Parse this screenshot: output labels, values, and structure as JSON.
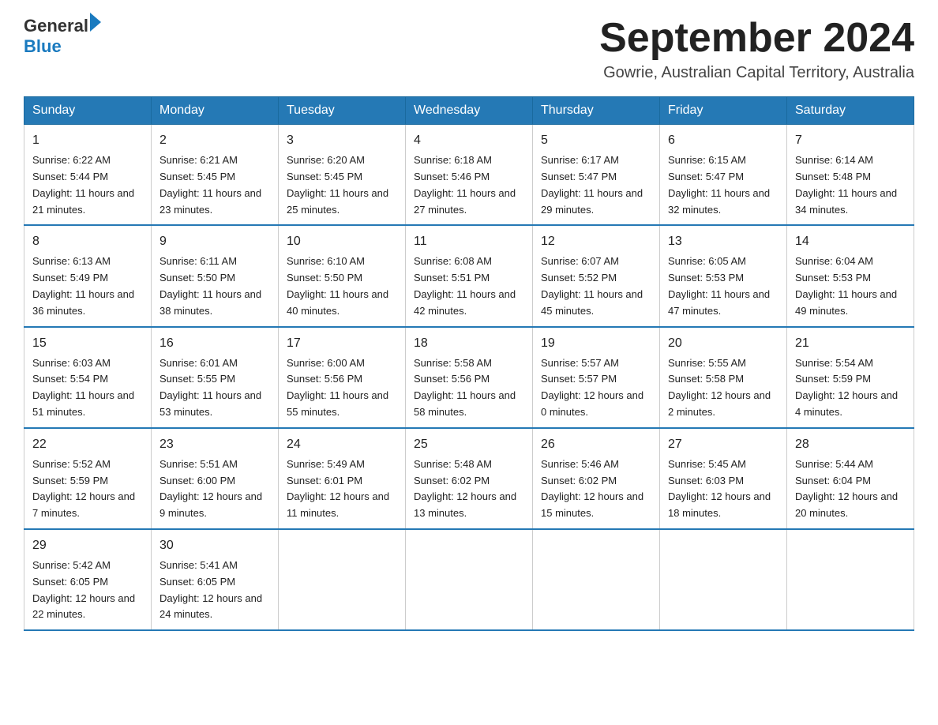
{
  "logo": {
    "general": "General",
    "blue": "Blue"
  },
  "title": "September 2024",
  "location": "Gowrie, Australian Capital Territory, Australia",
  "weekdays": [
    "Sunday",
    "Monday",
    "Tuesday",
    "Wednesday",
    "Thursday",
    "Friday",
    "Saturday"
  ],
  "weeks": [
    [
      {
        "day": "1",
        "sunrise": "6:22 AM",
        "sunset": "5:44 PM",
        "daylight": "11 hours and 21 minutes."
      },
      {
        "day": "2",
        "sunrise": "6:21 AM",
        "sunset": "5:45 PM",
        "daylight": "11 hours and 23 minutes."
      },
      {
        "day": "3",
        "sunrise": "6:20 AM",
        "sunset": "5:45 PM",
        "daylight": "11 hours and 25 minutes."
      },
      {
        "day": "4",
        "sunrise": "6:18 AM",
        "sunset": "5:46 PM",
        "daylight": "11 hours and 27 minutes."
      },
      {
        "day": "5",
        "sunrise": "6:17 AM",
        "sunset": "5:47 PM",
        "daylight": "11 hours and 29 minutes."
      },
      {
        "day": "6",
        "sunrise": "6:15 AM",
        "sunset": "5:47 PM",
        "daylight": "11 hours and 32 minutes."
      },
      {
        "day": "7",
        "sunrise": "6:14 AM",
        "sunset": "5:48 PM",
        "daylight": "11 hours and 34 minutes."
      }
    ],
    [
      {
        "day": "8",
        "sunrise": "6:13 AM",
        "sunset": "5:49 PM",
        "daylight": "11 hours and 36 minutes."
      },
      {
        "day": "9",
        "sunrise": "6:11 AM",
        "sunset": "5:50 PM",
        "daylight": "11 hours and 38 minutes."
      },
      {
        "day": "10",
        "sunrise": "6:10 AM",
        "sunset": "5:50 PM",
        "daylight": "11 hours and 40 minutes."
      },
      {
        "day": "11",
        "sunrise": "6:08 AM",
        "sunset": "5:51 PM",
        "daylight": "11 hours and 42 minutes."
      },
      {
        "day": "12",
        "sunrise": "6:07 AM",
        "sunset": "5:52 PM",
        "daylight": "11 hours and 45 minutes."
      },
      {
        "day": "13",
        "sunrise": "6:05 AM",
        "sunset": "5:53 PM",
        "daylight": "11 hours and 47 minutes."
      },
      {
        "day": "14",
        "sunrise": "6:04 AM",
        "sunset": "5:53 PM",
        "daylight": "11 hours and 49 minutes."
      }
    ],
    [
      {
        "day": "15",
        "sunrise": "6:03 AM",
        "sunset": "5:54 PM",
        "daylight": "11 hours and 51 minutes."
      },
      {
        "day": "16",
        "sunrise": "6:01 AM",
        "sunset": "5:55 PM",
        "daylight": "11 hours and 53 minutes."
      },
      {
        "day": "17",
        "sunrise": "6:00 AM",
        "sunset": "5:56 PM",
        "daylight": "11 hours and 55 minutes."
      },
      {
        "day": "18",
        "sunrise": "5:58 AM",
        "sunset": "5:56 PM",
        "daylight": "11 hours and 58 minutes."
      },
      {
        "day": "19",
        "sunrise": "5:57 AM",
        "sunset": "5:57 PM",
        "daylight": "12 hours and 0 minutes."
      },
      {
        "day": "20",
        "sunrise": "5:55 AM",
        "sunset": "5:58 PM",
        "daylight": "12 hours and 2 minutes."
      },
      {
        "day": "21",
        "sunrise": "5:54 AM",
        "sunset": "5:59 PM",
        "daylight": "12 hours and 4 minutes."
      }
    ],
    [
      {
        "day": "22",
        "sunrise": "5:52 AM",
        "sunset": "5:59 PM",
        "daylight": "12 hours and 7 minutes."
      },
      {
        "day": "23",
        "sunrise": "5:51 AM",
        "sunset": "6:00 PM",
        "daylight": "12 hours and 9 minutes."
      },
      {
        "day": "24",
        "sunrise": "5:49 AM",
        "sunset": "6:01 PM",
        "daylight": "12 hours and 11 minutes."
      },
      {
        "day": "25",
        "sunrise": "5:48 AM",
        "sunset": "6:02 PM",
        "daylight": "12 hours and 13 minutes."
      },
      {
        "day": "26",
        "sunrise": "5:46 AM",
        "sunset": "6:02 PM",
        "daylight": "12 hours and 15 minutes."
      },
      {
        "day": "27",
        "sunrise": "5:45 AM",
        "sunset": "6:03 PM",
        "daylight": "12 hours and 18 minutes."
      },
      {
        "day": "28",
        "sunrise": "5:44 AM",
        "sunset": "6:04 PM",
        "daylight": "12 hours and 20 minutes."
      }
    ],
    [
      {
        "day": "29",
        "sunrise": "5:42 AM",
        "sunset": "6:05 PM",
        "daylight": "12 hours and 22 minutes."
      },
      {
        "day": "30",
        "sunrise": "5:41 AM",
        "sunset": "6:05 PM",
        "daylight": "12 hours and 24 minutes."
      },
      null,
      null,
      null,
      null,
      null
    ]
  ],
  "labels": {
    "sunrise": "Sunrise:",
    "sunset": "Sunset:",
    "daylight": "Daylight:"
  }
}
